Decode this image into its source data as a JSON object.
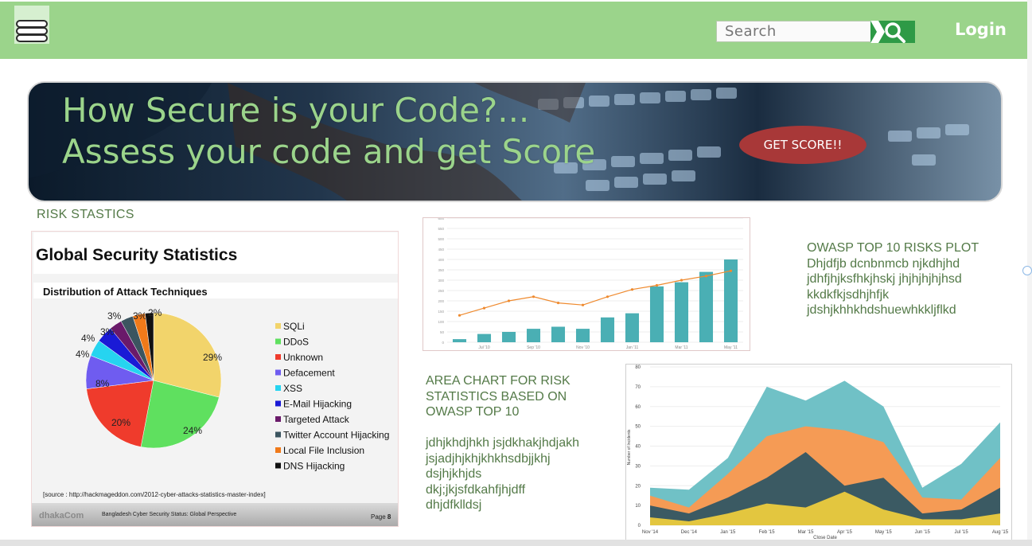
{
  "header": {
    "search_placeholder": "Search",
    "login_label": "Login",
    "menu_icon": "hamburger-icon",
    "search_icon": "search-icon"
  },
  "banner": {
    "line1": "How Secure is your Code?...",
    "line2": "Assess your code and get Score",
    "cta_label": "GET SCORE!!"
  },
  "risk_title": "RISK STASTICS",
  "stats_card": {
    "title": "Global Security Statistics",
    "subtitle": "Distribution of Attack Techniques",
    "source": "[source : http://hackmageddon.com/2012-cyber-attacks-statistics-master-index]",
    "footer_brand": "dhakaCom",
    "footer_caption": "Bangladesh Cyber Security Status: Global Perspective",
    "page_label": "Page",
    "page_number": "8"
  },
  "owasp": {
    "title": "OWASP TOP 10 RISKS PLOT",
    "lines": [
      "Dhjdfjb dcnbnmcb njkdhjhd",
      "jdhfjhjksfhkjhskj jhjhjhjhjhsd",
      "kkdkfkjsdhjhfjk",
      "jdshjkhhkhdshuewhkkljflkd"
    ]
  },
  "area_text": {
    "title_lines": [
      "AREA CHART FOR RISK",
      "STATISTICS BASED ON",
      "OWASP TOP 10"
    ],
    "lines": [
      "jdhjkhdjhkh jsjdkhakjhdjakh",
      "jsjadjhjkhjkhkhsdbjjkhj",
      "dsjhjkhjds",
      "dkj;jkjsfdkahfjhjdff",
      "dhjdfklldsj"
    ]
  },
  "chart_data": [
    {
      "type": "pie",
      "title": "Distribution of Attack Techniques",
      "labels": [
        "SQLi",
        "DDoS",
        "Unknown",
        "Defacement",
        "XSS",
        "E-Mail Hijacking",
        "Targeted Attack",
        "Twitter Account Hijacking",
        "Local File Inclusion",
        "DNS Hijacking"
      ],
      "values": [
        29,
        24,
        20,
        8,
        4,
        4,
        3,
        3,
        3,
        2
      ],
      "slice_labels": [
        "29%",
        "24%",
        "20%",
        "8%",
        "4%",
        "4%",
        "3%",
        "3%",
        "3%",
        "2%"
      ],
      "colors": [
        "#f2d46b",
        "#5fe05f",
        "#ef3b2c",
        "#6f5cf0",
        "#26d4f0",
        "#1a1ad6",
        "#6a1a6a",
        "#3c5560",
        "#f07a1a",
        "#111111"
      ],
      "legend_position": "right"
    },
    {
      "type": "bar",
      "overlay": "line",
      "categories": [
        "",
        "Jul '10",
        "",
        "Sep '10",
        "",
        "Nov '10",
        "",
        "Jan '11",
        "",
        "Mar '11",
        "",
        "May '11"
      ],
      "values": [
        15,
        40,
        50,
        65,
        75,
        65,
        120,
        140,
        270,
        290,
        340,
        400
      ],
      "line_values": [
        130,
        165,
        200,
        220,
        190,
        180,
        220,
        255,
        275,
        300,
        320,
        345
      ],
      "yticks": [
        0,
        50,
        100,
        150,
        200,
        250,
        300,
        350,
        400,
        450,
        500,
        550,
        600
      ],
      "ylim": [
        0,
        600
      ],
      "bar_color": "#4aafb4",
      "line_color": "#ef8a2e"
    },
    {
      "type": "area",
      "xlabel": "Close Date",
      "ylabel": "Number of Incidents",
      "categories": [
        "Nov '14",
        "Dec '14",
        "Jan '15",
        "Feb '15",
        "Mar '15",
        "Apr '15",
        "May '15",
        "Jun '15",
        "Jul '15",
        "Aug '15"
      ],
      "ylim": [
        0,
        80
      ],
      "yticks": [
        0,
        10,
        20,
        30,
        40,
        50,
        60,
        70,
        80
      ],
      "series": [
        {
          "color": "#e3c63f",
          "values": [
            4,
            2,
            6,
            11,
            9,
            17,
            8,
            3,
            3,
            6
          ]
        },
        {
          "color": "#3b5a63",
          "values": [
            10,
            6,
            14,
            24,
            37,
            20,
            24,
            6,
            8,
            19
          ]
        },
        {
          "color": "#f59b55",
          "values": [
            15,
            9,
            26,
            45,
            50,
            48,
            42,
            14,
            13,
            34
          ]
        },
        {
          "color": "#70c1c6",
          "values": [
            19,
            18,
            34,
            70,
            63,
            73,
            60,
            19,
            31,
            52
          ]
        }
      ]
    }
  ]
}
